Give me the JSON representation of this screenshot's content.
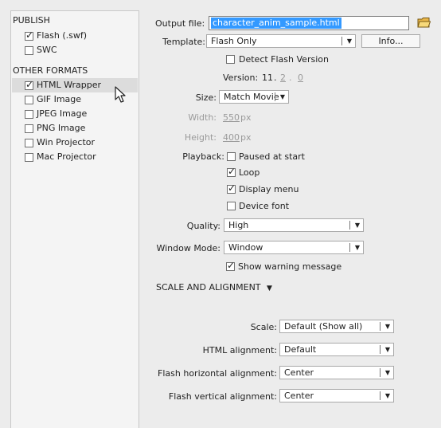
{
  "left_panel": {
    "publish_heading": "PUBLISH",
    "publish_items": [
      {
        "label": "Flash (.swf)",
        "checked": true
      },
      {
        "label": "SWC",
        "checked": false
      }
    ],
    "other_heading": "OTHER FORMATS",
    "other_items": [
      {
        "label": "HTML Wrapper",
        "checked": true
      },
      {
        "label": "GIF Image",
        "checked": false
      },
      {
        "label": "JPEG Image",
        "checked": false
      },
      {
        "label": "PNG Image",
        "checked": false
      },
      {
        "label": "Win Projector",
        "checked": false
      },
      {
        "label": "Mac Projector",
        "checked": false
      }
    ]
  },
  "output": {
    "label": "Output file:",
    "value": "character_anim_sample.html"
  },
  "template": {
    "label": "Template:",
    "value": "Flash Only",
    "info_button": "Info..."
  },
  "detect": {
    "label": "Detect Flash Version",
    "checked": false
  },
  "version": {
    "label": "Version:",
    "major": "11",
    "minor": "2",
    "patch": "0"
  },
  "size": {
    "label": "Size:",
    "value": "Match Movie"
  },
  "width": {
    "label": "Width:",
    "value": "550",
    "unit": "px"
  },
  "height": {
    "label": "Height:",
    "value": "400",
    "unit": "px"
  },
  "playback": {
    "label": "Playback:",
    "options": [
      {
        "label": "Paused at start",
        "checked": false
      },
      {
        "label": "Loop",
        "checked": true
      },
      {
        "label": "Display menu",
        "checked": true
      },
      {
        "label": "Device font",
        "checked": false
      }
    ]
  },
  "quality": {
    "label": "Quality:",
    "value": "High"
  },
  "window_mode": {
    "label": "Window Mode:",
    "value": "Window"
  },
  "show_warning": {
    "label": "Show warning message",
    "checked": true
  },
  "scale_section": {
    "label": "SCALE AND ALIGNMENT",
    "arrow": "▼"
  },
  "scale": {
    "label": "Scale:",
    "value": "Default (Show all)"
  },
  "html_alignment": {
    "label": "HTML alignment:",
    "value": "Default"
  },
  "flash_h_alignment": {
    "label": "Flash horizontal alignment:",
    "value": "Center"
  },
  "flash_v_alignment": {
    "label": "Flash vertical alignment:",
    "value": "Center"
  },
  "icons": {
    "folder": "folder-icon",
    "cursor": "mouse-cursor-icon",
    "check": "✓",
    "dropdown": "▼"
  }
}
